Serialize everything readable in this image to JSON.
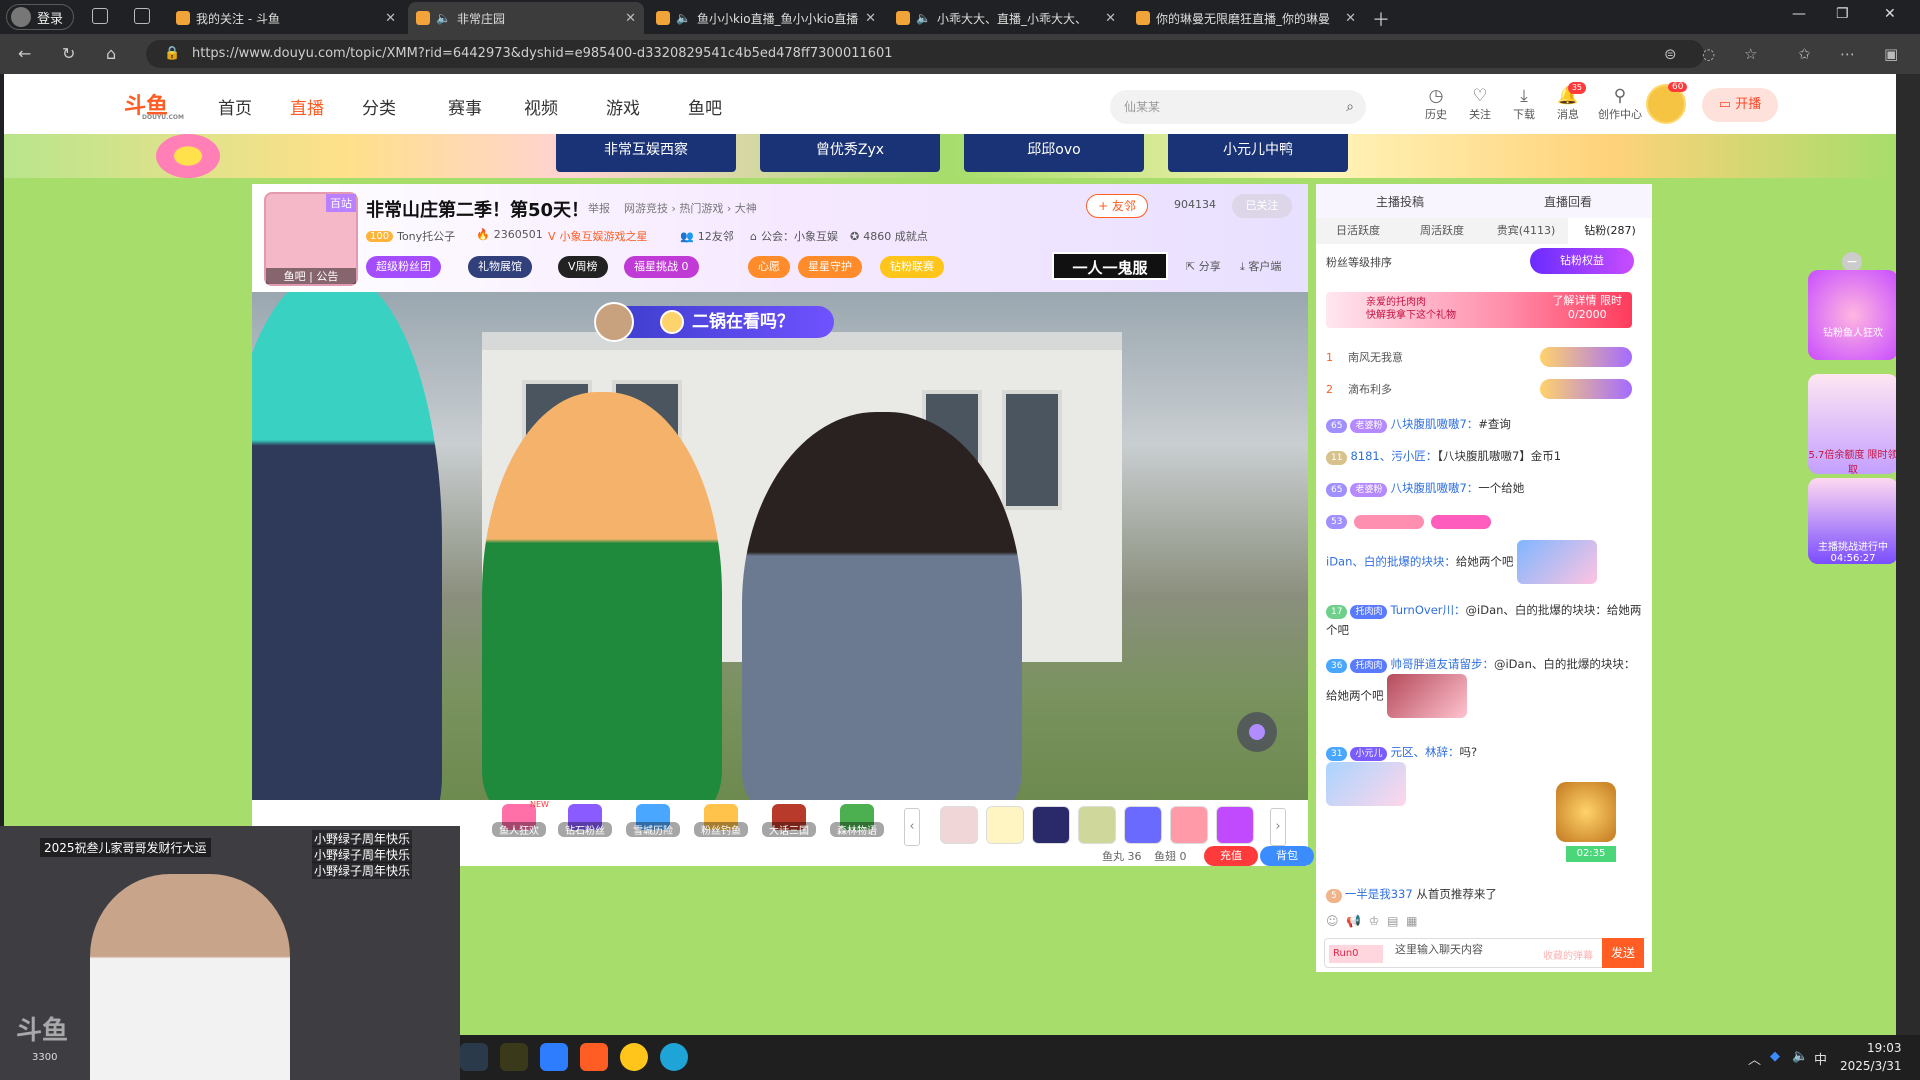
{
  "browser": {
    "profile_label": "登录",
    "tabs": [
      {
        "title": "我的关注 - 斗鱼",
        "active": false,
        "audio": false
      },
      {
        "title": "非常庄园",
        "active": true,
        "audio": true
      },
      {
        "title": "鱼小小kio直播_鱼小小kio直播",
        "active": false,
        "audio": true
      },
      {
        "title": "小乖大大、直播_小乖大大、",
        "active": false,
        "audio": true
      },
      {
        "title": "你的琳曼无限磨狂直播_你的琳曼",
        "active": false,
        "audio": false
      }
    ],
    "url": "https://www.douyu.com/topic/XMM?rid=6442973&dyshid=e985400-d3320829541c4b5ed478ff7300011601"
  },
  "site": {
    "logo_text": "斗鱼",
    "logo_sub": "DOUYU.COM",
    "nav": [
      "首页",
      "直播",
      "分类",
      "赛事",
      "视频",
      "游戏",
      "鱼吧"
    ],
    "search_placeholder": "仙某某",
    "header_icons": [
      {
        "label": "历史",
        "icon": "clock-icon"
      },
      {
        "label": "关注",
        "icon": "heart-icon"
      },
      {
        "label": "下载",
        "icon": "download-icon"
      },
      {
        "label": "消息",
        "icon": "bell-icon",
        "badge": "35"
      },
      {
        "label": "创作中心",
        "icon": "location-icon"
      }
    ],
    "avatar_badge": "60",
    "start_stream": "开播"
  },
  "banner_tabs": [
    "非常互娱西察",
    "曾优秀Zyx",
    "邱邱ovo",
    "小元儿中鸭"
  ],
  "room": {
    "avatar_badge": "百站",
    "avatar_labels": "鱼吧 | 公告",
    "title": "非常山庄第二季！第50天！",
    "tag1": "举报",
    "category": "网游竞技 › 热门游戏 › 大神",
    "level": "100",
    "host": "Tony托公子",
    "hot": "2360501",
    "union": "小象互娱游戏之星",
    "friends": "12友邻",
    "guild": "公会：小象互娱",
    "points": "4860 成就点",
    "pills": [
      "超级粉丝团",
      "礼物展馆",
      "V周榜",
      "福星挑战  0",
      "心愿",
      "星星守护",
      "钻粉联赛"
    ],
    "follow": "+ 友邻",
    "follow_count": "904134",
    "followed": "已关注",
    "yiren": "一人一鬼服",
    "share": "分享",
    "client": "客户端"
  },
  "video": {
    "overlay_question": "二锅在看吗？"
  },
  "giftbar": {
    "gifts": [
      "鱼人狂欢",
      "钻石粉丝",
      "雪城历险",
      "粉丝钓鱼",
      "大话三国",
      "森林物语"
    ],
    "new_tag": "NEW",
    "fishball": "鱼丸 36",
    "fishwing": "鱼翅 0",
    "recharge": "充值",
    "backpack": "背包"
  },
  "chat": {
    "top": [
      "主播投稿",
      "直播回看"
    ],
    "tabs": [
      "日活跃度",
      "周活跃度",
      "贵宾(4113)",
      "钻粉(287)"
    ],
    "rank_title": "粉丝等级排序",
    "diamond_rights": "钻粉权益",
    "promo_line1": "亲爱的托肉肉",
    "promo_line2": "快解我拿下这个礼物",
    "promo_right": "了解详情 限时",
    "promo_progress": "0/2000",
    "rank": [
      {
        "num": "1",
        "name": "南风无我意"
      },
      {
        "num": "2",
        "name": "滴布利多"
      }
    ],
    "messages": [
      {
        "lv": "65",
        "tag": "老婆粉",
        "nick": "八块腹肌嗷嗷7：",
        "text": "#查询"
      },
      {
        "lv": "11",
        "tag": "",
        "nick": "8181、污小匠：",
        "text": "【八块腹肌嗷嗷7】金币1"
      },
      {
        "lv": "65",
        "tag": "老婆粉",
        "nick": "八块腹肌嗷嗷7：",
        "text": "一个给她"
      },
      {
        "lv": "53",
        "tag": "",
        "nick": "",
        "text": ""
      },
      {
        "lv": "",
        "tag": "",
        "nick": "iDan、白的批爆的块块：",
        "text": "给她两个吧"
      },
      {
        "lv": "17",
        "tag": "托肉肉",
        "nick": "TurnOver川：",
        "text": "@iDan、白的批爆的块块：给她两个吧"
      },
      {
        "lv": "36",
        "tag": "托肉肉",
        "nick": "帅哥胖道友请留步：",
        "text": "@iDan、白的批爆的块块：给她两个吧"
      },
      {
        "lv": "31",
        "tag": "小元儿",
        "nick": "元区、林辞：",
        "text": "吗?"
      },
      {
        "lv": "5",
        "tag": "",
        "nick": "一半是我337",
        "text": "从首页推荐来了"
      }
    ],
    "chest_time": "02:35",
    "input_placeholder": "这里输入聊天内容",
    "input_badge": "Run0",
    "input_hint": "收藏的弹幕",
    "send": "发送"
  },
  "right_promos": [
    {
      "label": "钻粉鱼人狂欢"
    },
    {
      "label": "5.7倍余额度 限时领取"
    },
    {
      "label": "主播挑战进行中 04:56:27"
    }
  ],
  "pip": {
    "banner": "2025祝叁儿家哥哥发财行大运",
    "lines": [
      "小野绿子周年快乐",
      "小野绿子周年快乐",
      "小野绿子周年快乐"
    ],
    "logo": "斗鱼",
    "num": "3300"
  },
  "taskbar": {
    "ime": "中",
    "time": "19:03",
    "date": "2025/3/31"
  }
}
